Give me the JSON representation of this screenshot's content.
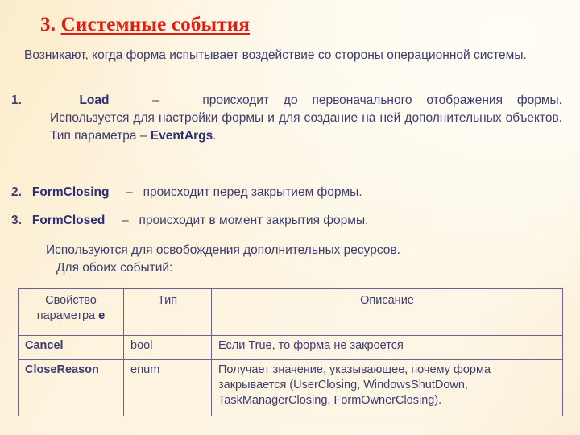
{
  "slide": {
    "title_number": "3.",
    "title_text": "Системные события",
    "intro": "Возникают, когда форма испытывает воздействие со стороны операционной системы.",
    "items": [
      {
        "number": "1.",
        "name": "Load",
        "dash": "–",
        "line1_tail": "происходит до первоначального отображения формы.",
        "rest_before": "Используется для настройки формы и для создание на ней дополнительных объектов. Тип параметра – ",
        "rest_keyword": "EventArgs",
        "rest_after": "."
      },
      {
        "number": "2.",
        "name": "FormClosing",
        "dash": "–",
        "description": "происходит перед закрытием формы."
      },
      {
        "number": "3.",
        "name": "FormClosed",
        "dash": "–",
        "description": "происходит в момент закрытия формы."
      }
    ],
    "note_line1": "Используются для освобождения дополнительных ресурсов.",
    "note_line2": "Для обоих событий:",
    "colors": {
      "title": "#e31b10",
      "body_text": "#3d3c70",
      "keyword": "#2e2d78",
      "table_border": "#6b6192",
      "background": "#fdf3dd"
    }
  },
  "table": {
    "headers": {
      "col1_line1": "Свойство",
      "col1_line2_prefix": "параметра ",
      "col1_line2_bold": "e",
      "col2": "Тип",
      "col3": "Описание"
    },
    "rows": [
      {
        "property": "Cancel",
        "type": "bool",
        "description": "Если True, то форма не закроется"
      },
      {
        "property": "CloseReason",
        "type": "enum",
        "description": "Получает значение, указывающее, почему форма закрывается (UserClosing, WindowsShutDown, TaskManagerClosing, FormOwnerClosing)."
      }
    ]
  }
}
